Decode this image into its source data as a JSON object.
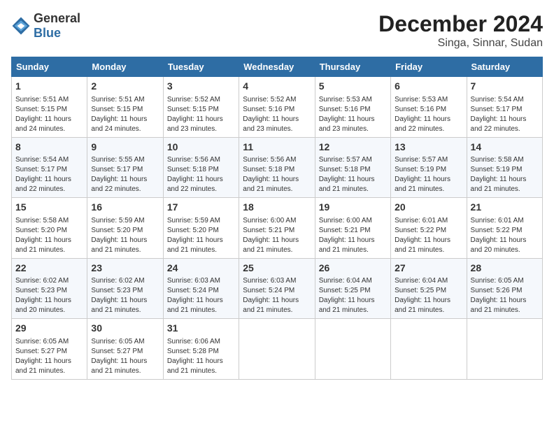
{
  "header": {
    "logo_general": "General",
    "logo_blue": "Blue",
    "title": "December 2024",
    "subtitle": "Singa, Sinnar, Sudan"
  },
  "days_of_week": [
    "Sunday",
    "Monday",
    "Tuesday",
    "Wednesday",
    "Thursday",
    "Friday",
    "Saturday"
  ],
  "weeks": [
    [
      {
        "day": "1",
        "info": "Sunrise: 5:51 AM\nSunset: 5:15 PM\nDaylight: 11 hours\nand 24 minutes."
      },
      {
        "day": "2",
        "info": "Sunrise: 5:51 AM\nSunset: 5:15 PM\nDaylight: 11 hours\nand 24 minutes."
      },
      {
        "day": "3",
        "info": "Sunrise: 5:52 AM\nSunset: 5:15 PM\nDaylight: 11 hours\nand 23 minutes."
      },
      {
        "day": "4",
        "info": "Sunrise: 5:52 AM\nSunset: 5:16 PM\nDaylight: 11 hours\nand 23 minutes."
      },
      {
        "day": "5",
        "info": "Sunrise: 5:53 AM\nSunset: 5:16 PM\nDaylight: 11 hours\nand 23 minutes."
      },
      {
        "day": "6",
        "info": "Sunrise: 5:53 AM\nSunset: 5:16 PM\nDaylight: 11 hours\nand 22 minutes."
      },
      {
        "day": "7",
        "info": "Sunrise: 5:54 AM\nSunset: 5:17 PM\nDaylight: 11 hours\nand 22 minutes."
      }
    ],
    [
      {
        "day": "8",
        "info": "Sunrise: 5:54 AM\nSunset: 5:17 PM\nDaylight: 11 hours\nand 22 minutes."
      },
      {
        "day": "9",
        "info": "Sunrise: 5:55 AM\nSunset: 5:17 PM\nDaylight: 11 hours\nand 22 minutes."
      },
      {
        "day": "10",
        "info": "Sunrise: 5:56 AM\nSunset: 5:18 PM\nDaylight: 11 hours\nand 22 minutes."
      },
      {
        "day": "11",
        "info": "Sunrise: 5:56 AM\nSunset: 5:18 PM\nDaylight: 11 hours\nand 21 minutes."
      },
      {
        "day": "12",
        "info": "Sunrise: 5:57 AM\nSunset: 5:18 PM\nDaylight: 11 hours\nand 21 minutes."
      },
      {
        "day": "13",
        "info": "Sunrise: 5:57 AM\nSunset: 5:19 PM\nDaylight: 11 hours\nand 21 minutes."
      },
      {
        "day": "14",
        "info": "Sunrise: 5:58 AM\nSunset: 5:19 PM\nDaylight: 11 hours\nand 21 minutes."
      }
    ],
    [
      {
        "day": "15",
        "info": "Sunrise: 5:58 AM\nSunset: 5:20 PM\nDaylight: 11 hours\nand 21 minutes."
      },
      {
        "day": "16",
        "info": "Sunrise: 5:59 AM\nSunset: 5:20 PM\nDaylight: 11 hours\nand 21 minutes."
      },
      {
        "day": "17",
        "info": "Sunrise: 5:59 AM\nSunset: 5:20 PM\nDaylight: 11 hours\nand 21 minutes."
      },
      {
        "day": "18",
        "info": "Sunrise: 6:00 AM\nSunset: 5:21 PM\nDaylight: 11 hours\nand 21 minutes."
      },
      {
        "day": "19",
        "info": "Sunrise: 6:00 AM\nSunset: 5:21 PM\nDaylight: 11 hours\nand 21 minutes."
      },
      {
        "day": "20",
        "info": "Sunrise: 6:01 AM\nSunset: 5:22 PM\nDaylight: 11 hours\nand 21 minutes."
      },
      {
        "day": "21",
        "info": "Sunrise: 6:01 AM\nSunset: 5:22 PM\nDaylight: 11 hours\nand 20 minutes."
      }
    ],
    [
      {
        "day": "22",
        "info": "Sunrise: 6:02 AM\nSunset: 5:23 PM\nDaylight: 11 hours\nand 20 minutes."
      },
      {
        "day": "23",
        "info": "Sunrise: 6:02 AM\nSunset: 5:23 PM\nDaylight: 11 hours\nand 21 minutes."
      },
      {
        "day": "24",
        "info": "Sunrise: 6:03 AM\nSunset: 5:24 PM\nDaylight: 11 hours\nand 21 minutes."
      },
      {
        "day": "25",
        "info": "Sunrise: 6:03 AM\nSunset: 5:24 PM\nDaylight: 11 hours\nand 21 minutes."
      },
      {
        "day": "26",
        "info": "Sunrise: 6:04 AM\nSunset: 5:25 PM\nDaylight: 11 hours\nand 21 minutes."
      },
      {
        "day": "27",
        "info": "Sunrise: 6:04 AM\nSunset: 5:25 PM\nDaylight: 11 hours\nand 21 minutes."
      },
      {
        "day": "28",
        "info": "Sunrise: 6:05 AM\nSunset: 5:26 PM\nDaylight: 11 hours\nand 21 minutes."
      }
    ],
    [
      {
        "day": "29",
        "info": "Sunrise: 6:05 AM\nSunset: 5:27 PM\nDaylight: 11 hours\nand 21 minutes."
      },
      {
        "day": "30",
        "info": "Sunrise: 6:05 AM\nSunset: 5:27 PM\nDaylight: 11 hours\nand 21 minutes."
      },
      {
        "day": "31",
        "info": "Sunrise: 6:06 AM\nSunset: 5:28 PM\nDaylight: 11 hours\nand 21 minutes."
      },
      null,
      null,
      null,
      null
    ]
  ]
}
